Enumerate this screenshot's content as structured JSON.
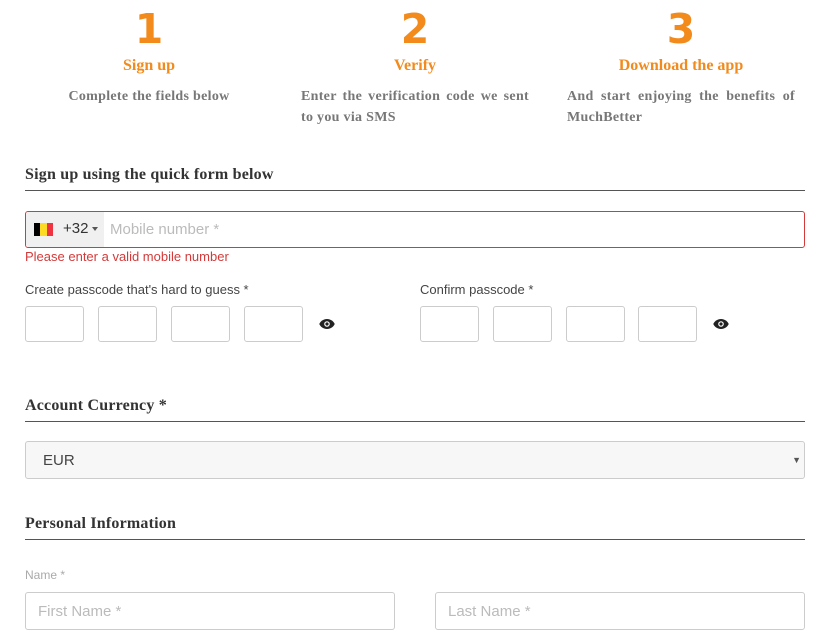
{
  "steps": [
    {
      "number": "1",
      "title": "Sign up",
      "description": "Complete the fields below"
    },
    {
      "number": "2",
      "title": "Verify",
      "description": "Enter the verification code we sent to you via SMS"
    },
    {
      "number": "3",
      "title": "Download the app",
      "description": "And start enjoying the benefits of MuchBetter"
    }
  ],
  "quick_form": {
    "title": "Sign up using the quick form below",
    "phone": {
      "country_flag": "flag-belgium-icon",
      "country_code": "+32",
      "placeholder": "Mobile number *",
      "value": "",
      "error": "Please enter a valid mobile number"
    },
    "passcode_label": "Create passcode that's hard to guess *",
    "confirm_label": "Confirm passcode *",
    "eye_icon": "eye-icon"
  },
  "currency": {
    "title": "Account Currency *",
    "selected": "EUR"
  },
  "personal": {
    "title": "Personal Information",
    "name_label": "Name *",
    "first_name_placeholder": "First Name *",
    "last_name_placeholder": "Last Name *"
  },
  "colors": {
    "accent": "#f28a1c",
    "error": "#d43a3a",
    "flag": [
      "#000000",
      "#fdda24",
      "#ef3340"
    ]
  }
}
